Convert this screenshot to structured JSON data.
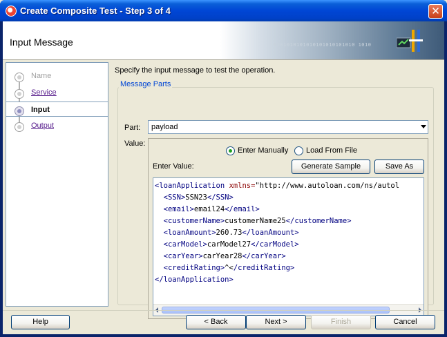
{
  "window": {
    "title": "Create Composite Test - Step 3 of 4",
    "close_label": "✕"
  },
  "banner": {
    "title": "Input Message",
    "binary": "0101010101010101010101010 1010"
  },
  "steps": [
    {
      "label": "Name",
      "state": "disabled"
    },
    {
      "label": "Service",
      "state": "link"
    },
    {
      "label": "Input",
      "state": "active"
    },
    {
      "label": "Output",
      "state": "link"
    }
  ],
  "main": {
    "description": "Specify the input message to test the operation.",
    "group_title": "Message Parts",
    "part_label": "Part:",
    "part_value": "payload",
    "value_label": "Value:",
    "radio_manual": "Enter Manually",
    "radio_file": "Load From File",
    "enter_value_label": "Enter Value:",
    "generate_button": "Generate Sample",
    "saveas_button": "Save As"
  },
  "editor": {
    "lines": [
      {
        "indent": "",
        "open": "<loanApplication",
        "attr": " xmlns=",
        "attrval": "\"http://www.autoloan.com/ns/autol",
        "value": "",
        "close": ""
      },
      {
        "indent": "  ",
        "open": "<SSN>",
        "attr": "",
        "attrval": "",
        "value": "SSN23",
        "close": "</SSN>"
      },
      {
        "indent": "  ",
        "open": "<email>",
        "attr": "",
        "attrval": "",
        "value": "email24",
        "close": "</email>"
      },
      {
        "indent": "  ",
        "open": "<customerName>",
        "attr": "",
        "attrval": "",
        "value": "customerName25",
        "close": "</customerName>"
      },
      {
        "indent": "  ",
        "open": "<loanAmount>",
        "attr": "",
        "attrval": "",
        "value": "260.73",
        "close": "</loanAmount>"
      },
      {
        "indent": "  ",
        "open": "<carModel>",
        "attr": "",
        "attrval": "",
        "value": "carModel27",
        "close": "</carModel>"
      },
      {
        "indent": "  ",
        "open": "<carYear>",
        "attr": "",
        "attrval": "",
        "value": "carYear28",
        "close": "</carYear>"
      },
      {
        "indent": "  ",
        "open": "<creditRating>",
        "attr": "",
        "attrval": "",
        "value": "^<",
        "close": "/creditRating>"
      },
      {
        "indent": "",
        "open": "</loanApplication>",
        "attr": "",
        "attrval": "",
        "value": "",
        "close": ""
      }
    ]
  },
  "footer": {
    "help": "Help",
    "back": "< Back",
    "next": "Next >",
    "finish": "Finish",
    "cancel": "Cancel"
  },
  "colors": {
    "title_bar": "#0046d5",
    "group_title": "#0046d5",
    "xml_tag": "#000080",
    "xml_attr": "#8b0000"
  }
}
